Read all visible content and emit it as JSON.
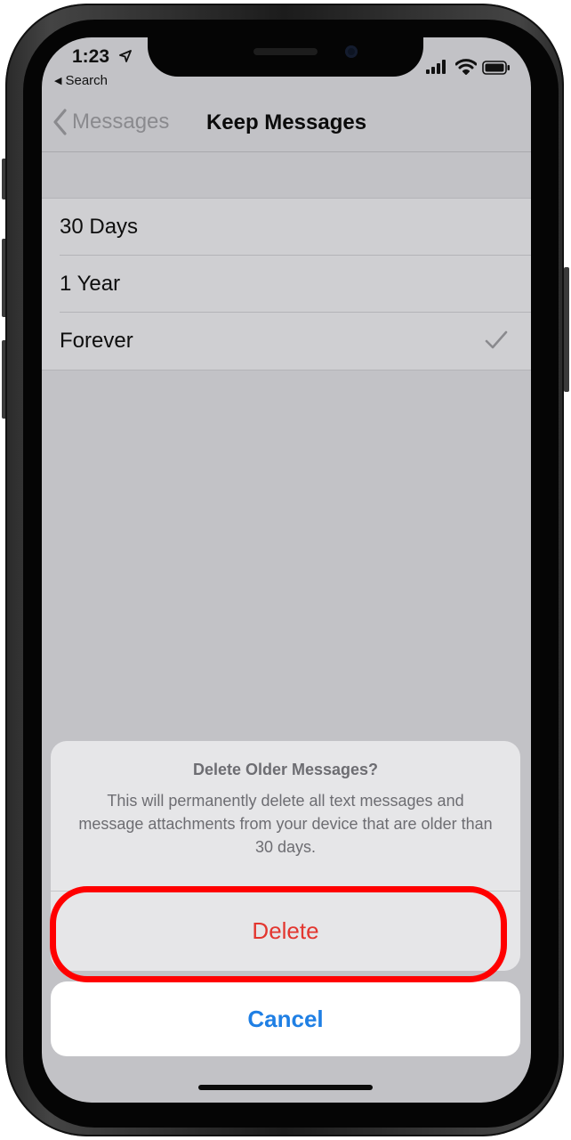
{
  "status_bar": {
    "time": "1:23",
    "back_app": "Search",
    "icons": [
      "location-arrow-icon",
      "signal-bars-icon",
      "wifi-icon",
      "battery-icon"
    ]
  },
  "nav": {
    "back_label": "Messages",
    "title": "Keep Messages"
  },
  "options": [
    {
      "label": "30 Days",
      "selected": false
    },
    {
      "label": "1 Year",
      "selected": false
    },
    {
      "label": "Forever",
      "selected": true
    }
  ],
  "action_sheet": {
    "title": "Delete Older Messages?",
    "message": "This will permanently delete all text messages and message attachments from your device that are older than 30 days.",
    "delete_label": "Delete",
    "cancel_label": "Cancel"
  },
  "colors": {
    "destructive": "#e3362f",
    "link": "#1f7fe4",
    "highlight": "#ff0000"
  }
}
